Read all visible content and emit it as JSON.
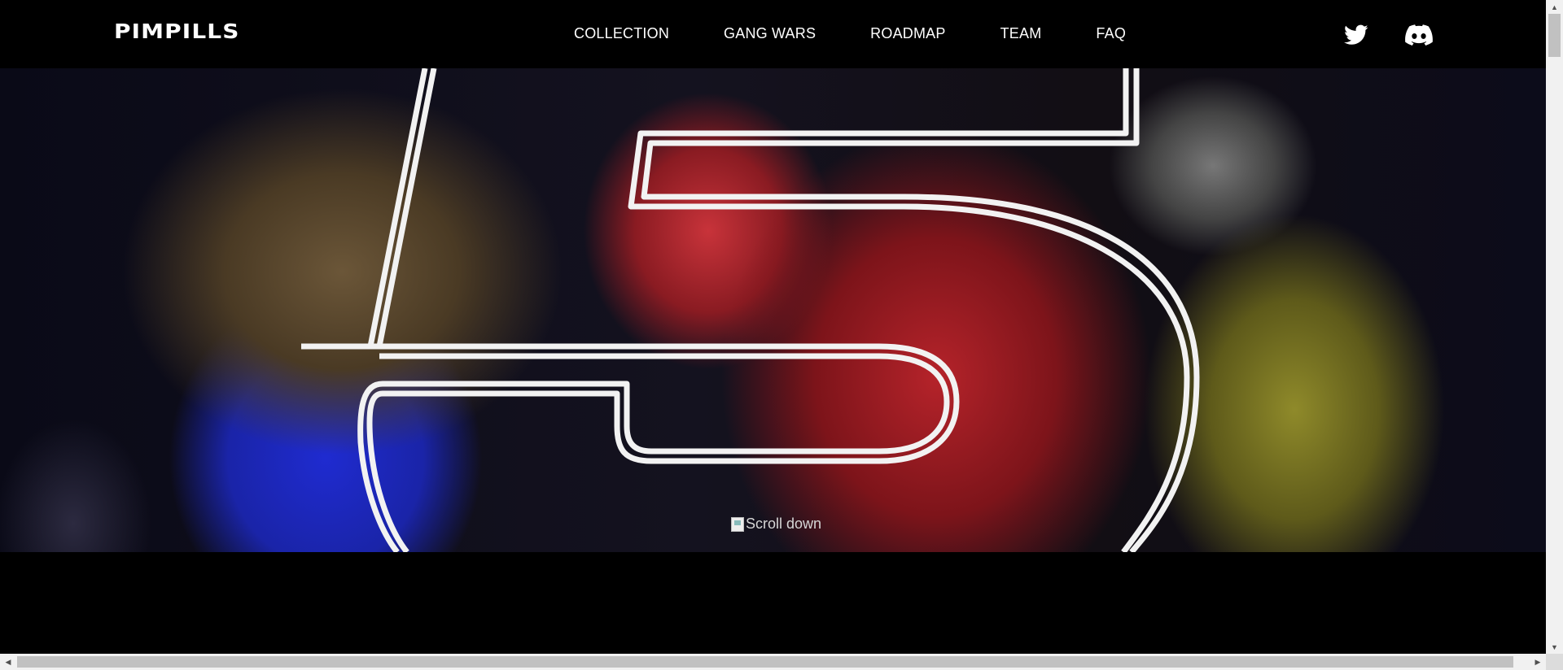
{
  "header": {
    "logo": "PIMPILLS",
    "nav": [
      {
        "label": "COLLECTION"
      },
      {
        "label": "GANG WARS"
      },
      {
        "label": "ROADMAP"
      },
      {
        "label": "TEAM"
      },
      {
        "label": "FAQ"
      }
    ],
    "social": [
      {
        "icon": "twitter-icon"
      },
      {
        "icon": "discord-icon"
      }
    ]
  },
  "hero": {
    "countdown_digit": "5",
    "scroll_image_alt": "Scroll down"
  },
  "colors": {
    "background": "#000000",
    "text": "#ffffff",
    "digit_outline": "#f2f2f2"
  }
}
